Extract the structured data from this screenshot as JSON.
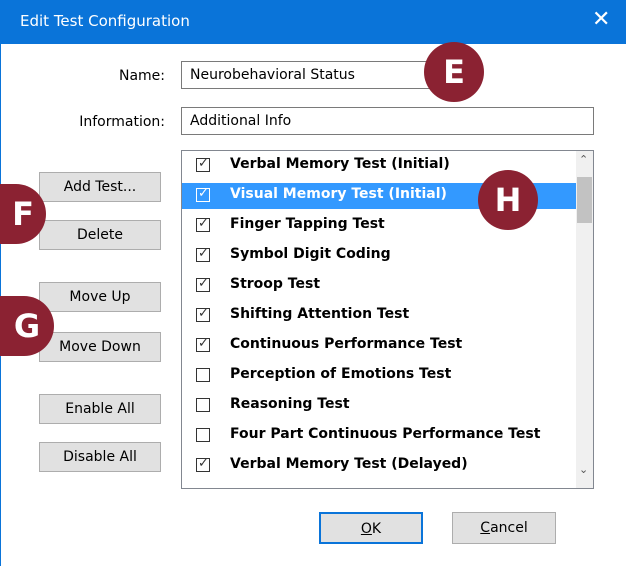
{
  "window": {
    "title": "Edit Test Configuration",
    "close_glyph": "✕"
  },
  "form": {
    "name_label": "Name:",
    "name_value": "Neurobehavioral Status",
    "info_label": "Information:",
    "info_value": "Additional Info"
  },
  "side_buttons": {
    "add_test": "Add Test...",
    "delete": "Delete",
    "move_up": "Move Up",
    "move_down": "Move Down",
    "enable_all": "Enable All",
    "disable_all": "Disable All"
  },
  "tests": [
    {
      "label": "Verbal Memory Test (Initial)",
      "checked": true,
      "selected": false
    },
    {
      "label": "Visual Memory Test (Initial)",
      "checked": true,
      "selected": true
    },
    {
      "label": "Finger Tapping Test",
      "checked": true,
      "selected": false
    },
    {
      "label": "Symbol Digit Coding",
      "checked": true,
      "selected": false
    },
    {
      "label": "Stroop Test",
      "checked": true,
      "selected": false
    },
    {
      "label": "Shifting Attention Test",
      "checked": true,
      "selected": false
    },
    {
      "label": "Continuous Performance Test",
      "checked": true,
      "selected": false
    },
    {
      "label": "Perception of Emotions Test",
      "checked": false,
      "selected": false
    },
    {
      "label": "Reasoning Test",
      "checked": false,
      "selected": false
    },
    {
      "label": "Four Part Continuous Performance Test",
      "checked": false,
      "selected": false
    },
    {
      "label": "Verbal Memory Test (Delayed)",
      "checked": true,
      "selected": false
    }
  ],
  "footer": {
    "ok_mnemonic": "O",
    "ok_rest": "K",
    "cancel_mnemonic": "C",
    "cancel_rest": "ancel"
  },
  "badges": {
    "e": "E",
    "f": "F",
    "g": "G",
    "h": "H"
  },
  "colors": {
    "titlebar": "#0a74d9",
    "selection": "#3399ff",
    "badge": "#8b2232"
  },
  "icons": {
    "checked": "✓",
    "scroll_up": "⌃",
    "scroll_down": "⌄"
  }
}
